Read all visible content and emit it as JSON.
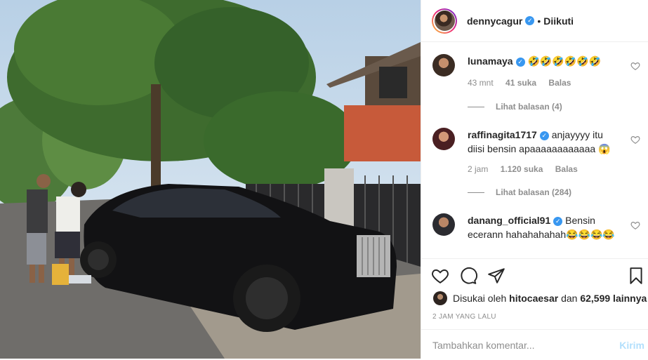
{
  "post": {
    "username": "dennycagur",
    "separator": "•",
    "follow_status": "Diikuti"
  },
  "comments": [
    {
      "username": "lunamaya",
      "text": "🤣🤣🤣🤣🤣🤣",
      "time": "43 mnt",
      "likes": "41 suka",
      "reply_label": "Balas",
      "view_replies": "Lihat balasan (4)"
    },
    {
      "username": "raffinagita1717",
      "text": "anjayyyy itu diisi bensin apaaaaaaaaaaaa 😱",
      "time": "2 jam",
      "likes": "1.120 suka",
      "reply_label": "Balas",
      "view_replies": "Lihat balasan (284)"
    },
    {
      "username": "danang_official91",
      "text": "Bensin ecerann hahahahahah😂😂😂😂"
    }
  ],
  "likes": {
    "prefix": "Disukai oleh",
    "user": "hitocaesar",
    "middle": "dan",
    "count": "62,599 lainnya"
  },
  "timestamp": "2 JAM YANG LALU",
  "add_comment": {
    "placeholder": "Tambahkan komentar...",
    "post_label": "Kirim"
  },
  "icons": [
    "heart-icon",
    "comment-icon",
    "share-icon",
    "bookmark-icon",
    "verified-icon"
  ],
  "colors": {
    "verified": "#3897f0",
    "muted": "#8e8e8e",
    "text": "#262626",
    "post_disabled": "#b2dffc"
  }
}
